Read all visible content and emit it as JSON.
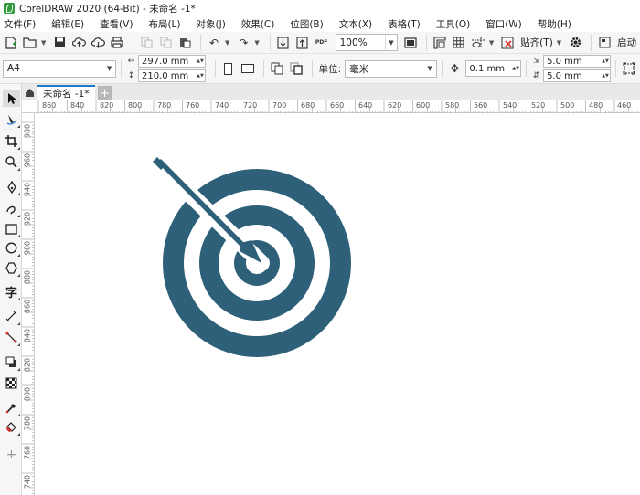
{
  "window": {
    "title": "CorelDRAW 2020 (64-Bit) - 未命名 -1*"
  },
  "menu": [
    "文件(F)",
    "编辑(E)",
    "查看(V)",
    "布局(L)",
    "对象(J)",
    "效果(C)",
    "位图(B)",
    "文本(X)",
    "表格(T)",
    "工具(O)",
    "窗口(W)",
    "帮助(H)"
  ],
  "toolbar": {
    "zoom": "100%",
    "snap_label": "贴齐(T)",
    "launch_label": "启动",
    "pdf_label": "PDF"
  },
  "property_bar": {
    "page_size": "A4",
    "width": "297.0 mm",
    "height": "210.0 mm",
    "units_label": "单位:",
    "units": "毫米",
    "nudge": "0.1 mm",
    "dup_x": "5.0 mm",
    "dup_y": "5.0 mm"
  },
  "tabs": {
    "document": "未命名 -1*"
  },
  "rulers": {
    "horizontal": [
      "860",
      "840",
      "820",
      "800",
      "780",
      "760",
      "740",
      "720",
      "700",
      "680",
      "660",
      "640",
      "620",
      "600",
      "580",
      "560",
      "540",
      "520",
      "500",
      "480",
      "460"
    ],
    "vertical": [
      "980",
      "960",
      "940",
      "920",
      "900",
      "880",
      "860",
      "840",
      "820",
      "800",
      "780",
      "760",
      "740"
    ]
  },
  "colors": {
    "artwork": "#2e6079",
    "accent": "#1f78c8"
  }
}
